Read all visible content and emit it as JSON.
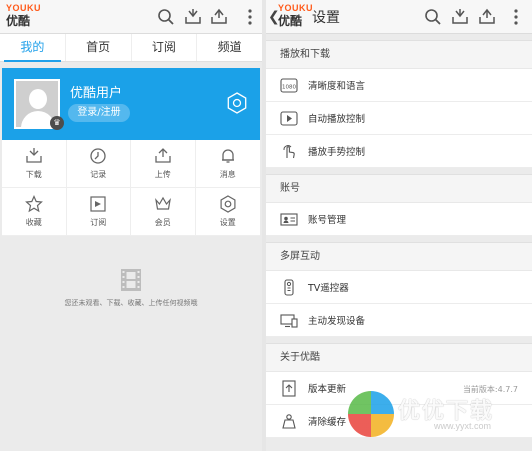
{
  "left": {
    "logo": {
      "en": "YOUKU",
      "cn": "优酷"
    },
    "tabs": [
      {
        "label": "我的",
        "active": true
      },
      {
        "label": "首页",
        "active": false
      },
      {
        "label": "订阅",
        "active": false
      },
      {
        "label": "频道",
        "active": false
      }
    ],
    "profile": {
      "name": "优酷用户",
      "login_label": "登录/注册"
    },
    "grid": [
      {
        "label": "下载",
        "icon": "download-icon"
      },
      {
        "label": "记录",
        "icon": "history-icon"
      },
      {
        "label": "上传",
        "icon": "upload-icon"
      },
      {
        "label": "消息",
        "icon": "bell-icon"
      },
      {
        "label": "收藏",
        "icon": "star-icon"
      },
      {
        "label": "订阅",
        "icon": "rss-icon"
      },
      {
        "label": "会员",
        "icon": "vip-icon"
      },
      {
        "label": "设置",
        "icon": "gear-icon"
      }
    ],
    "empty_text": "您还未观看、下载、收藏、上传任何视频哦"
  },
  "right": {
    "logo": {
      "en": "YOUKU",
      "cn": "优酷"
    },
    "title": "设置",
    "sections": [
      {
        "head": "播放和下载",
        "rows": [
          {
            "label": "清晰度和语言",
            "icon": "resolution-icon"
          },
          {
            "label": "自动播放控制",
            "icon": "play-icon"
          },
          {
            "label": "播放手势控制",
            "icon": "gesture-icon"
          }
        ]
      },
      {
        "head": "账号",
        "rows": [
          {
            "label": "账号管理",
            "icon": "account-card-icon"
          }
        ]
      },
      {
        "head": "多屏互动",
        "rows": [
          {
            "label": "TV遥控器",
            "icon": "remote-icon"
          },
          {
            "label": "主动发现设备",
            "icon": "screen-icon"
          }
        ]
      },
      {
        "head": "关于优酷",
        "rows": [
          {
            "label": "版本更新",
            "icon": "update-icon",
            "value": "当前版本:4.7.7"
          },
          {
            "label": "清除缓存",
            "icon": "broom-icon"
          }
        ]
      }
    ]
  },
  "watermark": {
    "title": "优优下载",
    "url": "www.yyxt.com"
  },
  "colors": {
    "accent": "#20a0ea",
    "profile_bg": "#1ba1e8",
    "logo": "#ff5a1a"
  }
}
